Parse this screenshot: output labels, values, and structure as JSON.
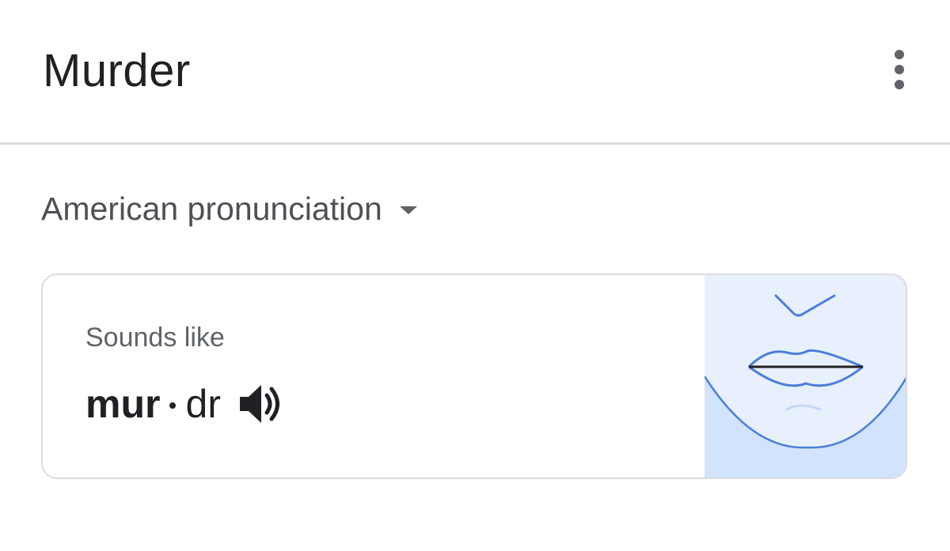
{
  "header": {
    "title": "Murder",
    "menu_icon": "more-vert-icon"
  },
  "accent": {
    "label": "American pronunciation",
    "dropdown_icon": "arrow-drop-down-icon"
  },
  "pronunciation_card": {
    "sounds_like_label": "Sounds like",
    "syllables": [
      {
        "text": "mur",
        "stressed": true
      },
      {
        "text": "dr",
        "stressed": false
      }
    ],
    "audio_icon": "speaker-icon",
    "illustration": "mouth-shape-illustration",
    "colors": {
      "illustration_bg": "#e8f0fe",
      "illustration_chin": "#d2e3fc",
      "illustration_line": "#4a7fd8"
    }
  }
}
